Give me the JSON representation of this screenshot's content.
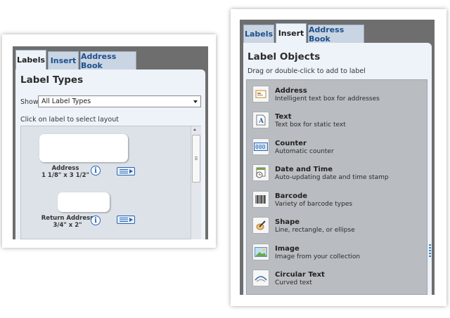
{
  "left_panel": {
    "tabs": [
      {
        "label": "Labels",
        "active": true
      },
      {
        "label": "Insert",
        "active": false
      },
      {
        "label": "Address Book",
        "active": false
      }
    ],
    "title": "Label Types",
    "show_label": "Show",
    "show_select": {
      "value": "All Label Types"
    },
    "hint": "Click on label to select layout",
    "labels": [
      {
        "name": "Address",
        "size": "1 1/8\" x 3 1/2\""
      },
      {
        "name": "Return Address",
        "size": "3/4\" x 2\""
      }
    ]
  },
  "right_panel": {
    "tabs": [
      {
        "label": "Labels",
        "active": false
      },
      {
        "label": "Insert",
        "active": true
      },
      {
        "label": "Address Book",
        "active": false
      }
    ],
    "title": "Label Objects",
    "subtitle": "Drag or double-click to add to label",
    "objects": [
      {
        "name": "Address",
        "description": "Intelligent text box for addresses",
        "icon": "address-icon"
      },
      {
        "name": "Text",
        "description": "Text box for static text",
        "icon": "text-icon"
      },
      {
        "name": "Counter",
        "description": "Automatic counter",
        "icon": "counter-icon"
      },
      {
        "name": "Date and Time",
        "description": "Auto-updating date and time stamp",
        "icon": "clock-icon"
      },
      {
        "name": "Barcode",
        "description": "Variety of barcode types",
        "icon": "barcode-icon"
      },
      {
        "name": "Shape",
        "description": "Line, rectangle, or ellipse",
        "icon": "shape-icon"
      },
      {
        "name": "Image",
        "description": "Image from your collection",
        "icon": "image-icon"
      },
      {
        "name": "Circular Text",
        "description": "Curved text",
        "icon": "circular-text-icon"
      }
    ]
  },
  "colors": {
    "tab_link": "#1d4f8c",
    "frame": "#6e6e6e",
    "pane": "#eef3f9",
    "list_bg": "#b9bdc1",
    "accent": "#2a64b0"
  }
}
